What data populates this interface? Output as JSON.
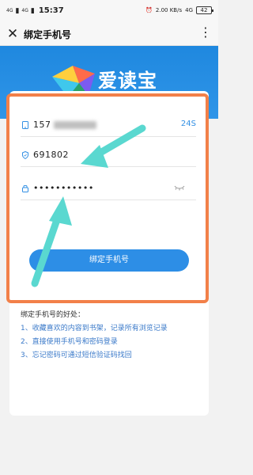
{
  "status_bar": {
    "sim1": "4G",
    "sim2": "4G",
    "time": "15:37",
    "net_speed": "2.00 KB/s",
    "network": "4G",
    "battery": "42"
  },
  "app_bar": {
    "title": "绑定手机号"
  },
  "brand": {
    "name": "爱读宝"
  },
  "form": {
    "phone_prefix": "157",
    "countdown": "24S",
    "code": "691802",
    "password": "•••••••••••",
    "submit_label": "绑定手机号"
  },
  "benefits": {
    "title": "绑定手机号的好处：",
    "items": [
      "1、收藏喜欢的内容到书架，记录所有浏览记录",
      "2、直接使用手机号和密码登录",
      "3、忘记密码可通过短信验证码找回"
    ]
  },
  "colors": {
    "accent": "#2d8ee6",
    "annotation_frame": "#f28049",
    "annotation_arrow": "#5ad8d0"
  }
}
